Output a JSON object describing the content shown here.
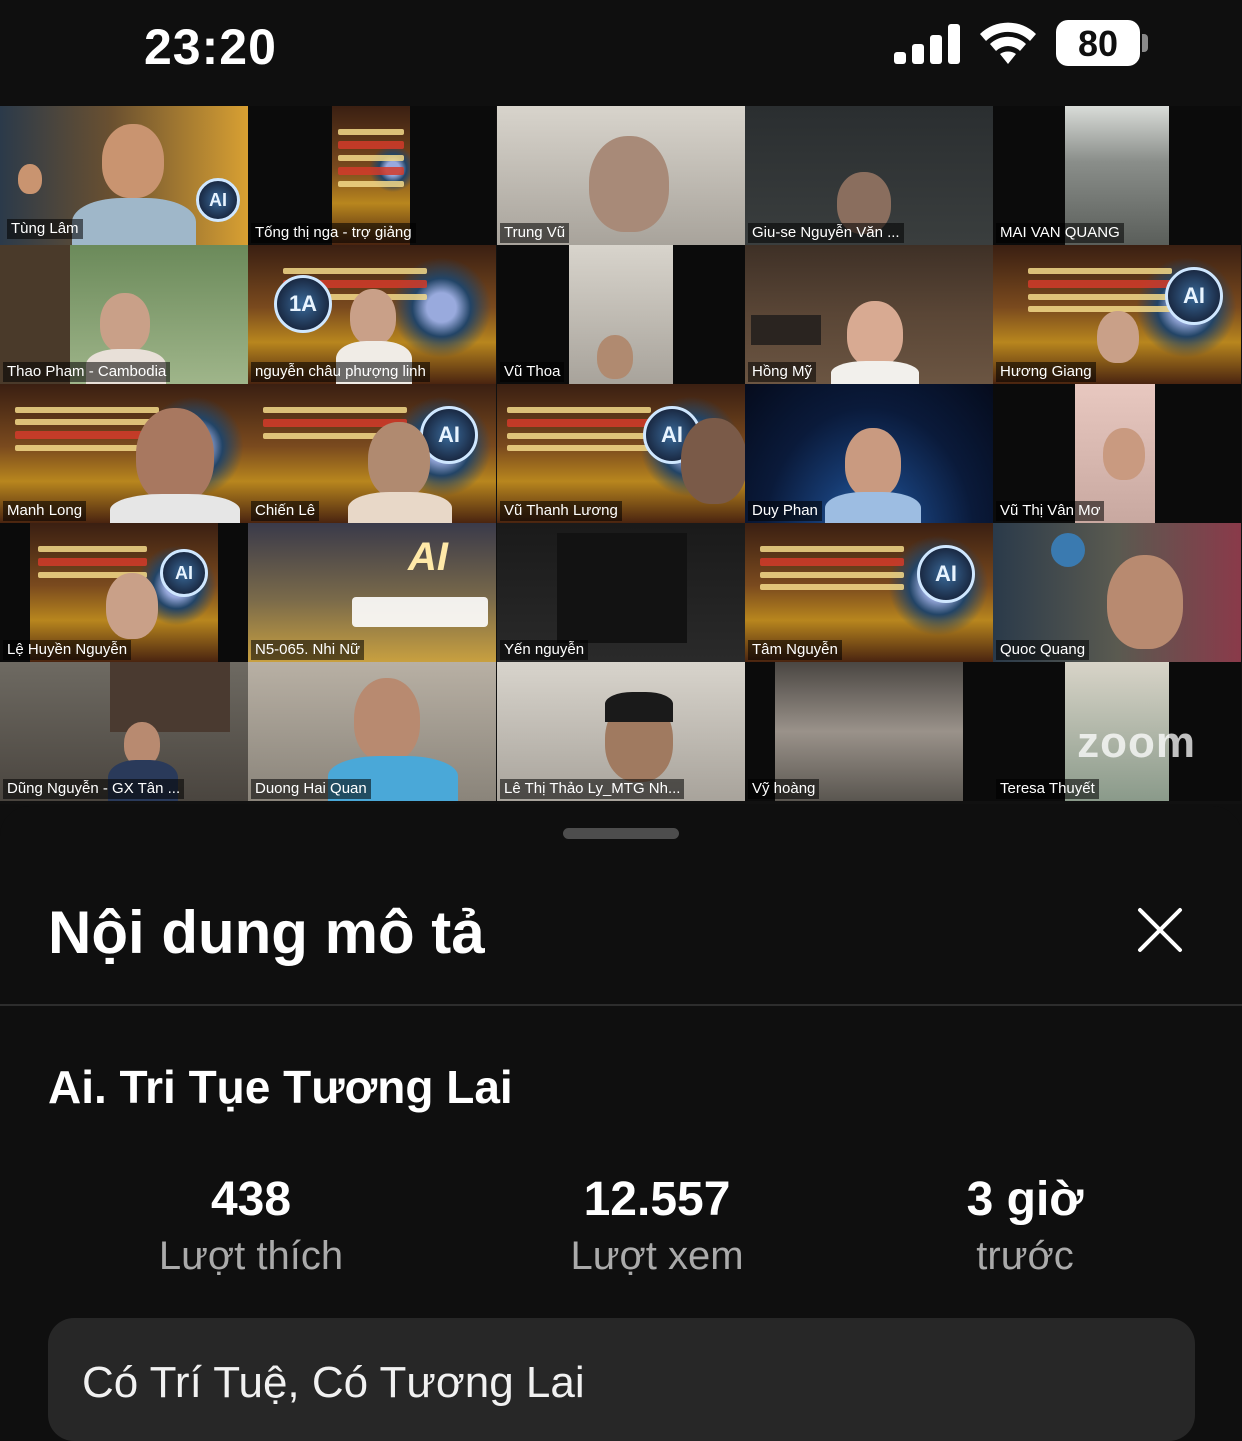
{
  "status_bar": {
    "time": "23:20",
    "battery": "80",
    "icons": [
      "cellular-signal-icon",
      "wifi-icon",
      "battery-icon"
    ]
  },
  "meeting": {
    "app_watermark": "zoom",
    "participants": [
      "Tùng Lâm",
      "Tống thị nga - trợ giảng",
      "Trung Vũ",
      "Giu-se Nguyễn Văn ...",
      "MAI VAN QUANG",
      "Thao Pham - Cambodia",
      "nguyễn châu phượng linh",
      "Vũ Thoa",
      "Hồng Mỹ",
      "Hương Giang",
      "Manh Long",
      "Chiến Lê",
      "Vũ Thanh Lương",
      "Duy Phan",
      "Vũ Thị Vân Mơ",
      "Lệ Huyền Nguyễn",
      "N5-065. Nhi Nữ",
      "Yến nguyễn",
      "Tâm Nguyễn",
      "Quoc Quang",
      "Dũng Nguyễn - GX Tân ...",
      "Duong Hai Quan",
      "Lê Thị Thảo Ly_MTG Nh...",
      "Vỹ hoàng",
      "Teresa Thuyết"
    ],
    "active_speaker_color": "#3ad43a"
  },
  "sheet": {
    "title": "Nội dung mô tả",
    "video_title": "Ai. Tri Tụe Tương Lai",
    "stats": [
      {
        "value": "438",
        "label": "Lượt thích"
      },
      {
        "value": "12.557",
        "label": "Lượt xem"
      },
      {
        "value": "3 giờ",
        "label": "trước"
      }
    ],
    "description": "Có Trí Tuệ, Có Tương Lai"
  }
}
